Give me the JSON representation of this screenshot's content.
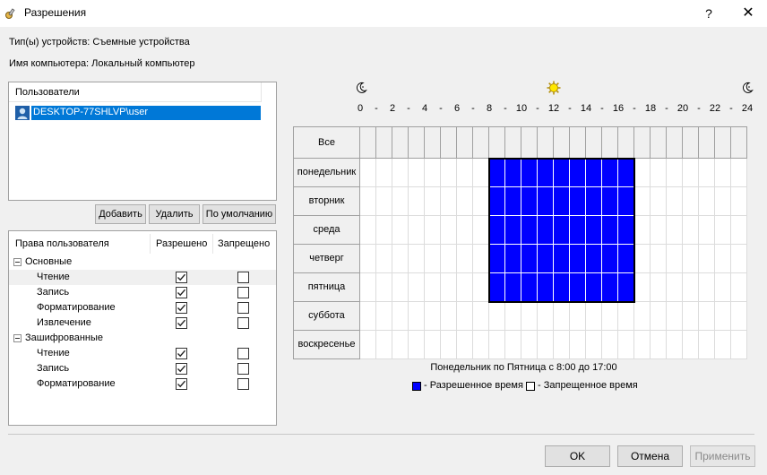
{
  "window": {
    "title": "Разрешения",
    "help_label": "?",
    "close_label": "✕",
    "icon": "permissions-key-icon"
  },
  "info": {
    "device_types": "Тип(ы) устройств: Съемные устройства",
    "computer_name": "Имя компьютера: Локальный компьютер"
  },
  "users": {
    "header": "Пользователи",
    "items": [
      {
        "label": "DESKTOP-77SHLVP\\user",
        "selected": true,
        "icon": "user-icon"
      }
    ],
    "buttons": {
      "add": "Добавить",
      "remove": "Удалить",
      "default": "По умолчанию"
    }
  },
  "rights": {
    "columns": [
      "Права пользователя",
      "Разрешено",
      "Запрещено"
    ],
    "groups": [
      {
        "label": "Основные",
        "items": [
          {
            "label": "Чтение",
            "allowed": true,
            "denied": false,
            "selected": true
          },
          {
            "label": "Запись",
            "allowed": true,
            "denied": false
          },
          {
            "label": "Форматирование",
            "allowed": true,
            "denied": false
          },
          {
            "label": "Извлечение",
            "allowed": true,
            "denied": false
          }
        ]
      },
      {
        "label": "Зашифрованные",
        "items": [
          {
            "label": "Чтение",
            "allowed": true,
            "denied": false
          },
          {
            "label": "Запись",
            "allowed": true,
            "denied": false
          },
          {
            "label": "Форматирование",
            "allowed": true,
            "denied": false
          }
        ]
      }
    ]
  },
  "schedule": {
    "icons": [
      "moon-icon",
      "sun-icon",
      "moon-icon"
    ],
    "hour_labels": [
      "0",
      "2",
      "4",
      "6",
      "8",
      "10",
      "12",
      "14",
      "16",
      "18",
      "20",
      "22",
      "24"
    ],
    "all_label": "Все",
    "days": [
      "понедельник",
      "вторник",
      "среда",
      "четверг",
      "пятница",
      "суббота",
      "воскресенье"
    ],
    "allowed_days": [
      0,
      1,
      2,
      3,
      4
    ],
    "allowed_hours": [
      8,
      17
    ],
    "allowed_color": "#0000ff",
    "summary": "Понедельник по Пятница с 8:00 до 17:00",
    "legend": {
      "allowed": "- Разрешенное время",
      "denied": "- Запрещенное время"
    }
  },
  "footer": {
    "ok": "OK",
    "cancel": "Отмена",
    "apply": "Применить"
  }
}
